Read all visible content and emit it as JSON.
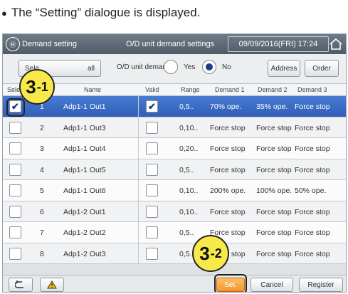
{
  "caption": {
    "bullet": "●",
    "text": "The “Setting” dialogue is displayed."
  },
  "titlebar": {
    "icon_text": "Ⓜ",
    "title": "Demand setting",
    "center": "O/D unit demand settings",
    "datetime": "09/09/2016(FRI) 17:24",
    "home_icon": "home-icon"
  },
  "toolbar": {
    "select_btn": "Sele",
    "all_btn": "all",
    "mode_label": "O/D unit demand",
    "radio_yes": "Yes",
    "radio_no": "No",
    "selected_radio": "No",
    "address_btn": "Address",
    "order_btn": "Order"
  },
  "headers": {
    "select": "Select",
    "name": "Name",
    "valid": "Valid",
    "range": "Range",
    "demand1": "Demand 1",
    "demand2": "Demand 2",
    "demand3": "Demand 3"
  },
  "rows": [
    {
      "num": "1",
      "name": "Adp1-1 Out1",
      "select": true,
      "valid": true,
      "range": "0,5..",
      "d1": "70% ope.",
      "d2": "35% ope.",
      "d3": "Force stop",
      "selected": true
    },
    {
      "num": "2",
      "name": "Adp1-1 Out3",
      "select": false,
      "valid": false,
      "range": "0,10..",
      "d1": "Force stop",
      "d2": "Force stop",
      "d3": "Force stop",
      "selected": false
    },
    {
      "num": "3",
      "name": "Adp1-1 Out4",
      "select": false,
      "valid": false,
      "range": "0,20..",
      "d1": "Force stop",
      "d2": "Force stop",
      "d3": "Force stop",
      "selected": false
    },
    {
      "num": "4",
      "name": "Adp1-1 Out5",
      "select": false,
      "valid": false,
      "range": "0,5..",
      "d1": "Force stop",
      "d2": "Force stop",
      "d3": "Force stop",
      "selected": false
    },
    {
      "num": "5",
      "name": "Adp1-1 Out6",
      "select": false,
      "valid": false,
      "range": "0,10..",
      "d1": "200% ope.",
      "d2": "100% ope.",
      "d3": "50% ope.",
      "selected": false
    },
    {
      "num": "6",
      "name": "Adp1-2 Out1",
      "select": false,
      "valid": false,
      "range": "0,10..",
      "d1": "Force stop",
      "d2": "Force stop",
      "d3": "Force stop",
      "selected": false
    },
    {
      "num": "7",
      "name": "Adp1-2 Out2",
      "select": false,
      "valid": false,
      "range": "0,5..",
      "d1": "Force stop",
      "d2": "Force stop",
      "d3": "Force stop",
      "selected": false
    },
    {
      "num": "8",
      "name": "Adp1-2 Out3",
      "select": false,
      "valid": false,
      "range": "0,5..",
      "d1": "Force stop",
      "d2": "Force stop",
      "d3": "Force stop",
      "selected": false
    }
  ],
  "bottombar": {
    "back_icon": "back-icon",
    "warning_icon": "warning-icon",
    "set_btn": "Set.",
    "cancel_btn": "Cancel",
    "register_btn": "Register"
  },
  "callouts": {
    "c1_main": "3",
    "c1_sub": "-1",
    "c2_main": "3",
    "c2_sub": "-2"
  },
  "colors": {
    "selected_row": "#3a6cc6",
    "set_button": "#f5a23a",
    "callout_fill": "#f7e94a",
    "titlebar": "#5f6c78"
  }
}
